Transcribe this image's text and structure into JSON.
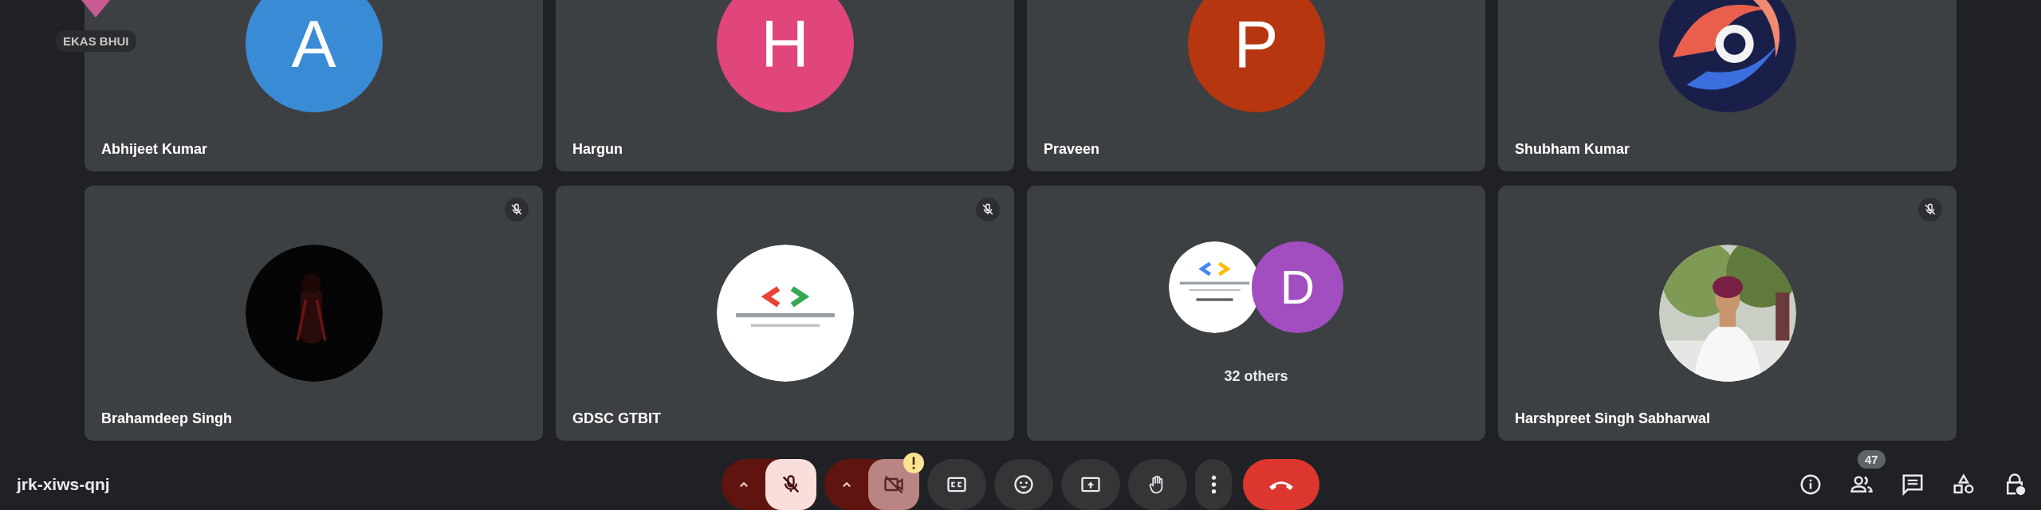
{
  "self_view": {
    "name": "EKAS BHUI"
  },
  "tiles": [
    {
      "name": "Abhijeet Kumar",
      "kind": "letter",
      "letter": "A",
      "color": "#3a8bd6",
      "muted": false
    },
    {
      "name": "Hargun",
      "kind": "letter",
      "letter": "H",
      "color": "#e0457b",
      "muted": false
    },
    {
      "name": "Praveen",
      "kind": "letter",
      "letter": "P",
      "color": "#b5360f",
      "muted": false
    },
    {
      "name": "Shubham Kumar",
      "kind": "picture",
      "muted": false
    },
    {
      "name": "Brahamdeep Singh",
      "kind": "picture",
      "muted": true
    },
    {
      "name": "GDSC GTBIT",
      "kind": "logo",
      "muted": true
    },
    {
      "kind": "group",
      "letter": "D",
      "color": "#a24ec0",
      "others": "32 others",
      "muted": false
    },
    {
      "name": "Harshpreet Singh Sabharwal",
      "kind": "picture",
      "muted": true
    }
  ],
  "meeting_code": "jrk-xiws-qnj",
  "controls": {
    "mic_on": false,
    "camera_on": false,
    "camera_warning": true
  },
  "people_count": "47"
}
